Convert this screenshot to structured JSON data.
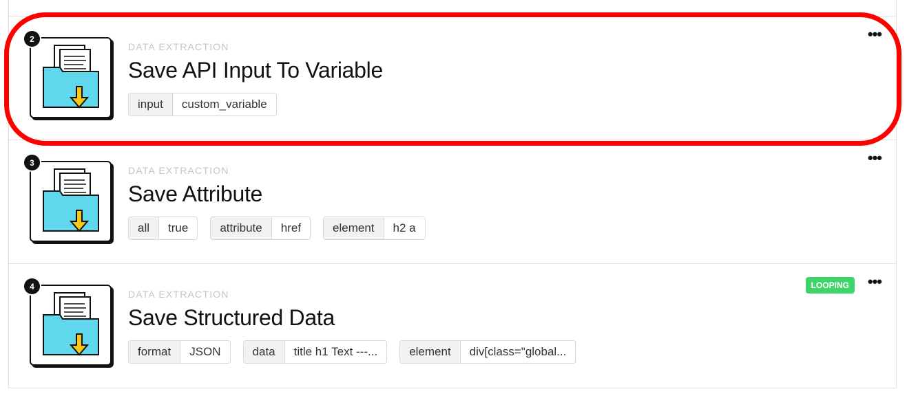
{
  "colors": {
    "highlight": "#ff0000",
    "looping_badge": "#3fd56b",
    "folder": "#5fd7ec",
    "arrow": "#f7c81b"
  },
  "steps": [
    {
      "number": "2",
      "category": "DATA EXTRACTION",
      "title": "Save API Input To Variable",
      "icon": "folder-download-icon",
      "params": [
        {
          "key": "input",
          "value": "custom_variable"
        }
      ],
      "badge": null,
      "highlighted": true
    },
    {
      "number": "3",
      "category": "DATA EXTRACTION",
      "title": "Save Attribute",
      "icon": "folder-download-icon",
      "params": [
        {
          "key": "all",
          "value": "true"
        },
        {
          "key": "attribute",
          "value": "href"
        },
        {
          "key": "element",
          "value": "h2 a"
        }
      ],
      "badge": null,
      "highlighted": false
    },
    {
      "number": "4",
      "category": "DATA EXTRACTION",
      "title": "Save Structured Data",
      "icon": "folder-download-icon",
      "params": [
        {
          "key": "format",
          "value": "JSON"
        },
        {
          "key": "data",
          "value": "title h1 Text ---..."
        },
        {
          "key": "element",
          "value": "div[class=\"global..."
        }
      ],
      "badge": "LOOPING",
      "highlighted": false
    }
  ],
  "more_label": "•••"
}
